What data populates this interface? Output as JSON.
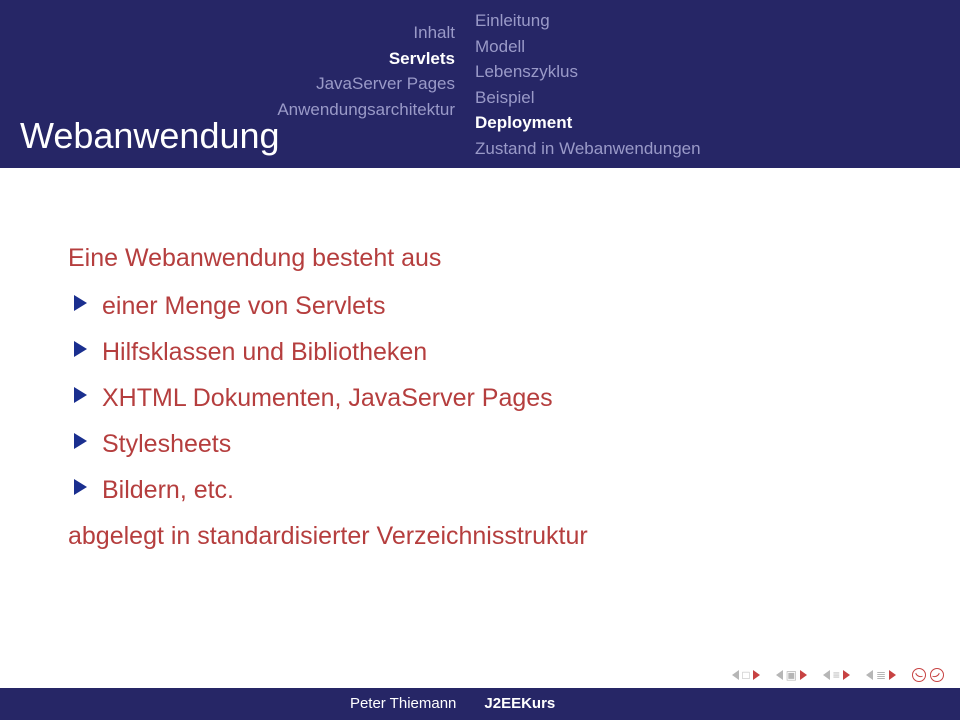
{
  "header": {
    "navLeft": [
      {
        "label": "Inhalt",
        "active": false
      },
      {
        "label": "Servlets",
        "active": true
      },
      {
        "label": "JavaServer Pages",
        "active": false
      },
      {
        "label": "Anwendungsarchitektur",
        "active": false
      }
    ],
    "navRight": [
      {
        "label": "Einleitung",
        "active": false
      },
      {
        "label": "Modell",
        "active": false
      },
      {
        "label": "Lebenszyklus",
        "active": false
      },
      {
        "label": "Beispiel",
        "active": false
      },
      {
        "label": "Deployment",
        "active": true
      },
      {
        "label": "Zustand in Webanwendungen",
        "active": false
      }
    ]
  },
  "title": "Webanwendung",
  "body": {
    "intro": "Eine Webanwendung besteht aus",
    "items": [
      "einer Menge von Servlets",
      "Hilfsklassen und Bibliotheken",
      "XHTML Dokumenten, JavaServer Pages",
      "Stylesheets",
      "Bildern, etc."
    ],
    "outro": "abgelegt in standardisierter Verzeichnisstruktur"
  },
  "footer": {
    "author": "Peter Thiemann",
    "course": "J2EEKurs"
  }
}
